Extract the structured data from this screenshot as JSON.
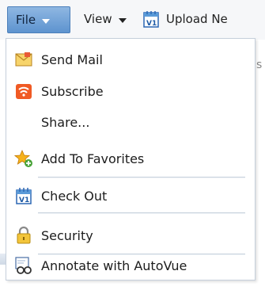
{
  "toolbar": {
    "file_label": "File",
    "view_label": "View",
    "upload_label": "Upload Ne"
  },
  "background_fragment": "s",
  "menu": {
    "items": [
      {
        "label": "Send Mail",
        "icon": "envelope-icon"
      },
      {
        "label": "Subscribe",
        "icon": "rss-icon"
      },
      {
        "label": "Share...",
        "icon": ""
      },
      {
        "label": "Add To Favorites",
        "icon": "star-add-icon"
      },
      {
        "label": "Check Out",
        "icon": "checkout-icon"
      },
      {
        "label": "Security",
        "icon": "lock-icon"
      },
      {
        "label": "Annotate with AutoVue",
        "icon": "autovue-icon"
      }
    ]
  },
  "colors": {
    "file_button_top": "#8fb7e2",
    "file_button_bottom": "#5d93cf",
    "separator": "#c9d3de"
  }
}
